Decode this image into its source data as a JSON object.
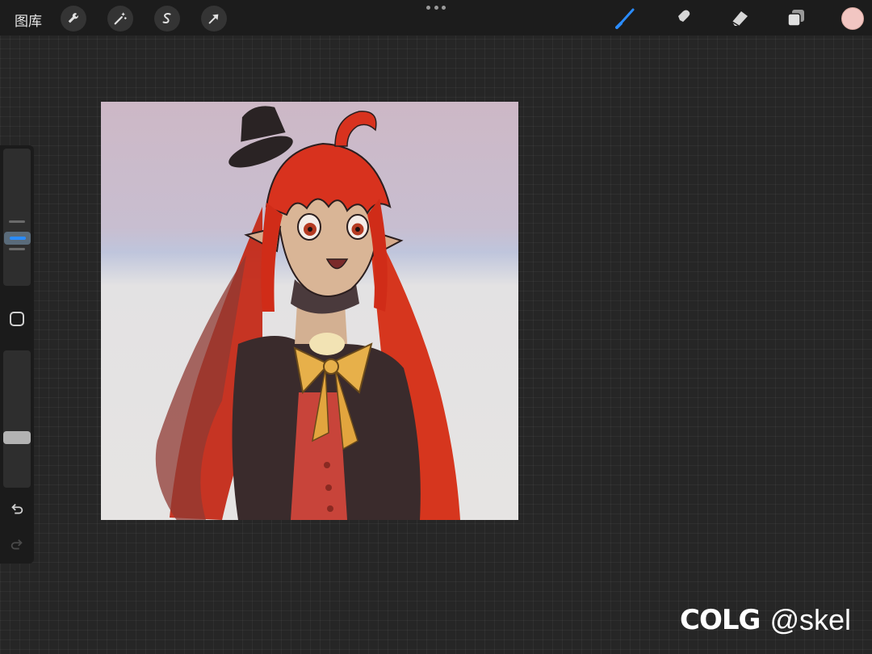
{
  "toolbar": {
    "gallery_label": "图库",
    "left_tools": [
      {
        "name": "actions",
        "icon": "wrench-icon"
      },
      {
        "name": "adjustments",
        "icon": "magic-wand-icon"
      },
      {
        "name": "selection",
        "icon": "selection-s-icon"
      },
      {
        "name": "transform",
        "icon": "arrow-cursor-icon"
      }
    ],
    "more_icon": "ellipsis-icon",
    "right_tools": [
      {
        "name": "brush",
        "icon": "brush-icon",
        "active": true
      },
      {
        "name": "smudge",
        "icon": "smudge-icon",
        "active": false
      },
      {
        "name": "eraser",
        "icon": "eraser-icon",
        "active": false
      },
      {
        "name": "layers",
        "icon": "layers-icon",
        "active": false
      }
    ],
    "current_color": "#f2c6c2",
    "active_color": "#2a8cff"
  },
  "sidebar": {
    "brush_size_icon": "brush-size-slider",
    "modify_icon": "square-modify-icon",
    "opacity_icon": "opacity-slider",
    "undo_icon": "undo-arrow-icon",
    "redo_icon": "redo-arrow-icon",
    "redo_enabled": false
  },
  "canvas": {
    "artwork": "anime-character-illustration",
    "colors": {
      "hair": "#d8321e",
      "jacket": "#3a2b2c",
      "bow": "#e7b04a",
      "vest": "#c8443a",
      "skin": "#d9b596",
      "hat": "#2a2324"
    }
  },
  "watermark": {
    "logo": "COLG",
    "handle": "@skel"
  }
}
